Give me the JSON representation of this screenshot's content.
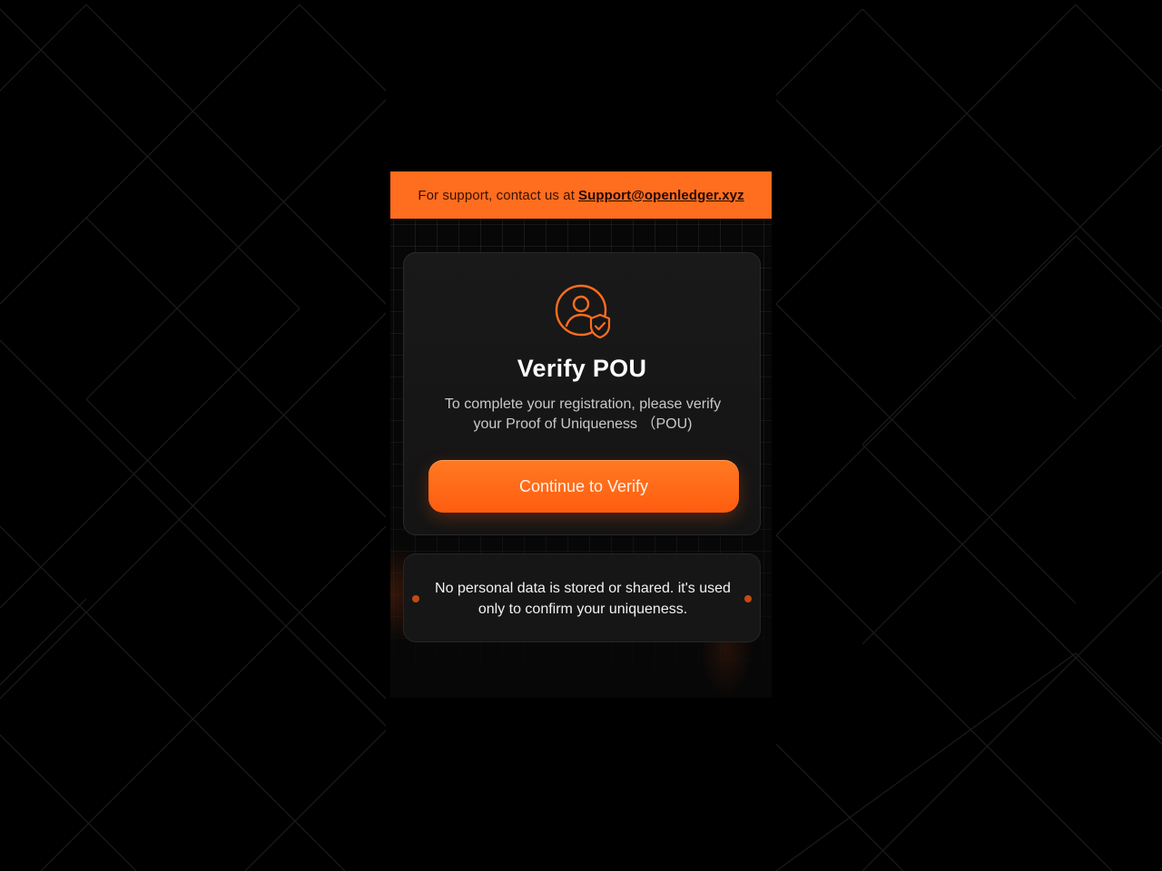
{
  "support": {
    "prefix": "For support, contact us at",
    "email": "Support@openledger.xyz"
  },
  "verify_card": {
    "icon": "user-shield-check-icon",
    "title": "Verify POU",
    "description": "To complete your registration, please verify your Proof of Uniqueness （POU)",
    "button_label": "Continue to Verify"
  },
  "notice": {
    "text": "No personal data is stored or shared. it's used only to confirm your uniqueness."
  },
  "colors": {
    "accent": "#ff6d1f",
    "background": "#000000",
    "card": "#171717",
    "dot": "#c24a12"
  }
}
